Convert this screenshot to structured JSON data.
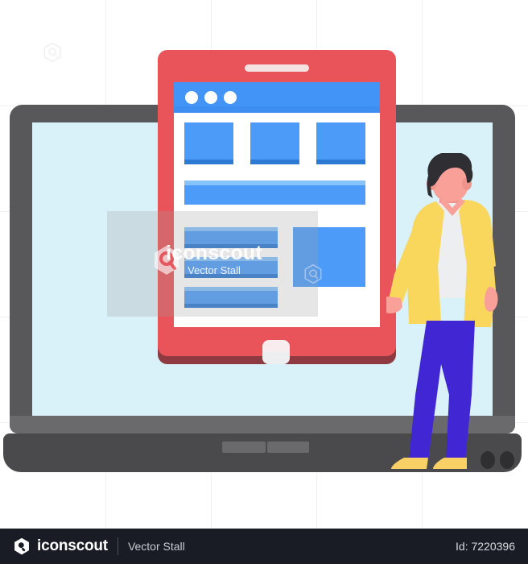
{
  "footer": {
    "brand": "iconscout",
    "contributor": "Vector Stall",
    "id_label": "Id: 7220396",
    "logo_icon": "iconscout-hexagon-logo-icon",
    "divider": "footer-divider"
  },
  "watermark": {
    "word": "iconscout",
    "sub": "Vector Stall",
    "hex_icon": "iconscout-hexagon-watermark-icon"
  },
  "illustration": {
    "title": "person presenting tablet web design on laptop screen",
    "colors": {
      "laptop_bezel": "#58585a",
      "laptop_screen": "#d9f2f9",
      "laptop_hinge": "#6a6a6c",
      "laptop_base": "#4a4a4c",
      "tablet_body": "#e8545a",
      "tablet_shadow": "#8e3a40",
      "browser_bar": "#4294f7",
      "card_blue": "#4d9bf8",
      "card_blue_dark": "#2c7ad4",
      "card_blue_light": "#86c3fb",
      "jacket_yellow": "#f9d65c",
      "shirt_white": "#eceef0",
      "pants_purple": "#4127d4",
      "skin": "#f9a099",
      "hair": "#2e2e33",
      "shoe_yellow": "#f9d065",
      "page_background": "#ffffff",
      "footer_background": "#191c24"
    },
    "laptop": {
      "name": "laptop",
      "base_keys": 2,
      "base_ports": 2
    },
    "tablet": {
      "name": "tablet",
      "speaker": "tablet-speaker",
      "home_button": "tablet-home-button"
    },
    "browser": {
      "name": "browser-window-mockup",
      "window_dots": 3,
      "cards": 3,
      "banner": "wide-banner-block",
      "list_rows": 3,
      "thumbnail": "image-thumbnail-block"
    },
    "person": {
      "name": "standing-person",
      "hair": "dark-curly-hair",
      "jacket": "yellow-open-jacket",
      "shirt": "white-tshirt",
      "pants": "purple-trousers",
      "shoes": "yellow-shoes",
      "pose": "left-arm-extended-presenting"
    }
  }
}
